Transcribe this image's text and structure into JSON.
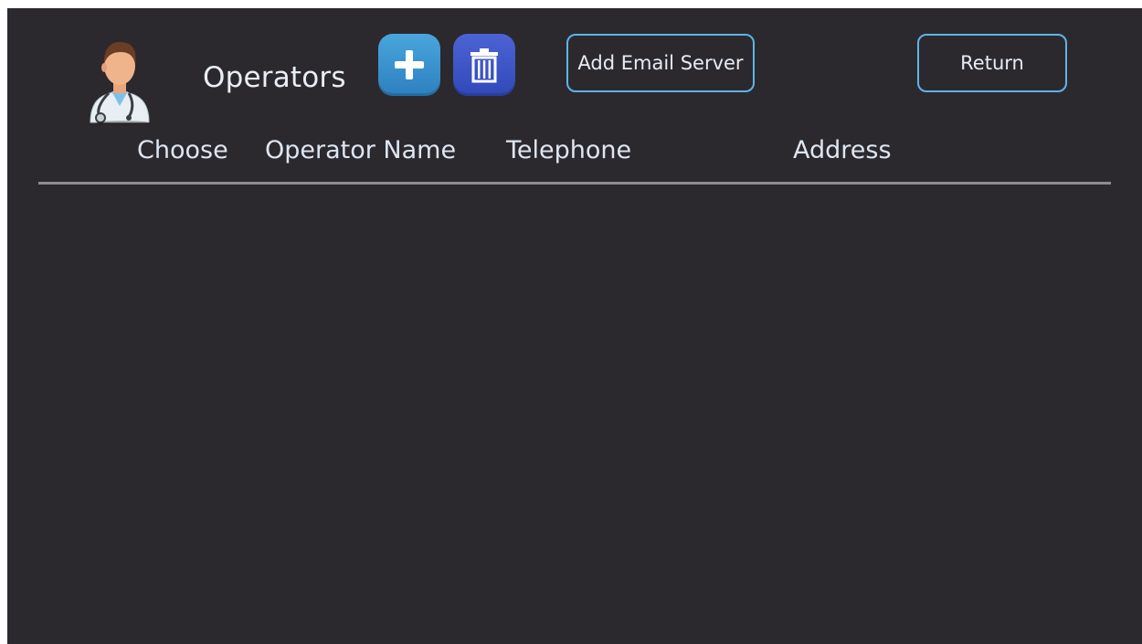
{
  "header": {
    "title": "Operators",
    "avatar_icon": "doctor-avatar-icon",
    "add_icon": "plus-icon",
    "delete_icon": "trash-icon",
    "email_server_label": "Add Email Server",
    "return_label": "Return"
  },
  "table": {
    "columns": [
      "Choose",
      "Operator Name",
      "Telephone",
      "Address"
    ],
    "rows": []
  },
  "colors": {
    "background": "#2c292e",
    "accent_outline": "#5cb5e6",
    "add_button": "#3a93d0",
    "delete_button": "#3f56c6",
    "divider": "#8e8b93"
  }
}
